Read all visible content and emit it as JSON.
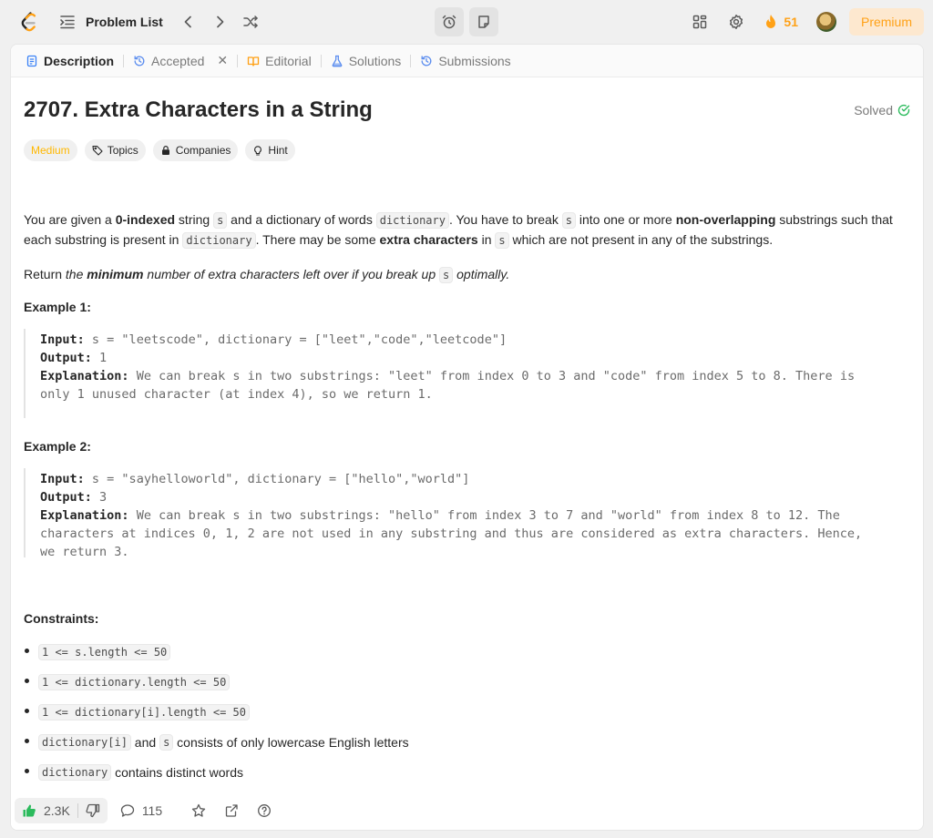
{
  "topbar": {
    "problem_list_label": "Problem List",
    "streak_count": "51",
    "premium_label": "Premium"
  },
  "tabs": [
    {
      "label": "Description",
      "icon": "document-icon"
    },
    {
      "label": "Accepted",
      "icon": "history-icon"
    },
    {
      "label": "Editorial",
      "icon": "book-icon"
    },
    {
      "label": "Solutions",
      "icon": "flask-icon"
    },
    {
      "label": "Submissions",
      "icon": "history-icon"
    }
  ],
  "problem": {
    "title": "2707. Extra Characters in a String",
    "solved_label": "Solved",
    "difficulty": "Medium",
    "tags": {
      "topics": "Topics",
      "companies": "Companies",
      "hint": "Hint"
    }
  },
  "description": {
    "p1_a": "You are given a ",
    "p1_b": "0-indexed",
    "p1_c": " string ",
    "p1_d": "s",
    "p1_e": " and a dictionary of words ",
    "p1_f": "dictionary",
    "p1_g": ". You have to break ",
    "p1_h": "s",
    "p1_i": " into one or more ",
    "p1_j": "non-overlapping",
    "p1_k": " substrings such that each substring is present in ",
    "p1_l": "dictionary",
    "p1_m": ". There may be some ",
    "p1_n": "extra characters",
    "p1_o": " in ",
    "p1_p": "s",
    "p1_q": " which are not present in any of the substrings.",
    "p2_a": "Return ",
    "p2_b": "the ",
    "p2_c": "minimum",
    "p2_d": " number of extra characters left over if you break up ",
    "p2_e": "s",
    "p2_f": " optimally."
  },
  "examples": [
    {
      "title": "Example 1:",
      "input_label": "Input:",
      "input": "s = \"leetscode\", dictionary = [\"leet\",\"code\",\"leetcode\"]",
      "output_label": "Output:",
      "output": "1",
      "explanation_label": "Explanation:",
      "explanation_line1": "We can break s in two substrings: \"leet\" from index 0 to 3 and \"code\" from index 5 to 8. There is",
      "explanation_line2": "only 1 unused character (at index 4), so we return 1."
    },
    {
      "title": "Example 2:",
      "input_label": "Input:",
      "input": "s = \"sayhelloworld\", dictionary = [\"hello\",\"world\"]",
      "output_label": "Output:",
      "output": "3",
      "explanation_label": "Explanation:",
      "explanation_line1": "We can break s in two substrings: \"hello\" from index 3 to 7 and \"world\" from index 8 to 12. The",
      "explanation_line2": "characters at indices 0, 1, 2 are not used in any substring and thus are considered as extra characters. Hence,",
      "explanation_line3": "we return 3."
    }
  ],
  "constraints": {
    "title": "Constraints:",
    "c1": "1 <= s.length <= 50",
    "c2": "1 <= dictionary.length <= 50",
    "c3": "1 <= dictionary[i].length <= 50",
    "c4_code1": "dictionary[i]",
    "c4_mid": " and ",
    "c4_code2": "s",
    "c4_tail": " consists of only lowercase English letters",
    "c5_code": "dictionary",
    "c5_tail": " contains distinct words"
  },
  "bottombar": {
    "likes": "2.3K",
    "comments": "115"
  },
  "colors": {
    "accent": "#ffa116",
    "medium": "#ffb800",
    "solved": "#2cbb5d",
    "likes": "#2cbb5d"
  }
}
